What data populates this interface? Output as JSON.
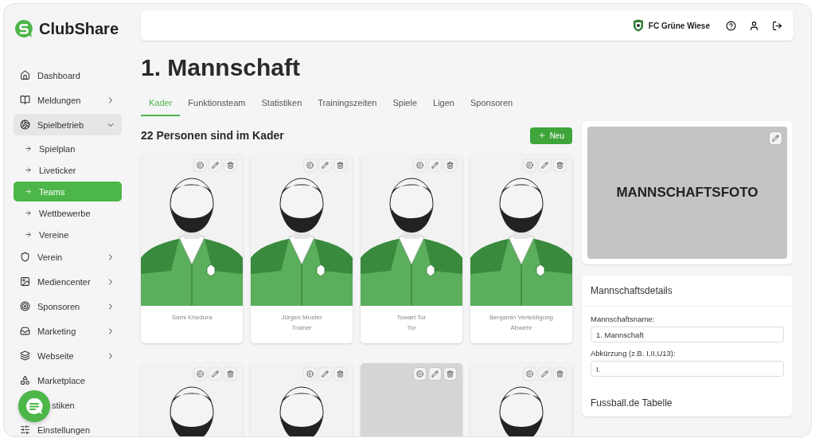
{
  "brand": {
    "name": "ClubShare"
  },
  "sidebar": {
    "items": [
      {
        "kind": "main",
        "label": "Dashboard",
        "expandable": false,
        "expanded": false,
        "selected": false
      },
      {
        "kind": "main",
        "label": "Meldungen",
        "expandable": true,
        "expanded": false,
        "selected": false
      },
      {
        "kind": "main",
        "label": "Spielbetrieb",
        "expandable": true,
        "expanded": true,
        "selected": false
      },
      {
        "kind": "sub",
        "label": "Spielplan",
        "selected": false
      },
      {
        "kind": "sub",
        "label": "Liveticker",
        "selected": false
      },
      {
        "kind": "sub",
        "label": "Teams",
        "selected": true
      },
      {
        "kind": "sub",
        "label": "Wettbewerbe",
        "selected": false
      },
      {
        "kind": "sub",
        "label": "Vereine",
        "selected": false
      },
      {
        "kind": "main",
        "label": "Verein",
        "expandable": true,
        "expanded": false,
        "selected": false
      },
      {
        "kind": "main",
        "label": "Mediencenter",
        "expandable": true,
        "expanded": false,
        "selected": false
      },
      {
        "kind": "main",
        "label": "Sponsoren",
        "expandable": true,
        "expanded": false,
        "selected": false
      },
      {
        "kind": "main",
        "label": "Marketing",
        "expandable": true,
        "expanded": false,
        "selected": false
      },
      {
        "kind": "main",
        "label": "Webseite",
        "expandable": true,
        "expanded": false,
        "selected": false
      },
      {
        "kind": "main",
        "label": "Marketplace",
        "expandable": false,
        "expanded": false,
        "selected": false
      },
      {
        "kind": "covered",
        "label": "stiken",
        "expandable": false,
        "expanded": false,
        "selected": false
      },
      {
        "kind": "main",
        "label": "Einstellungen",
        "expandable": false,
        "expanded": false,
        "selected": false
      }
    ]
  },
  "header": {
    "club": "FC Grüne Wiese"
  },
  "page": {
    "title": "1. Mannschaft"
  },
  "tabs": [
    {
      "label": "Kader",
      "selected": true
    },
    {
      "label": "Funktionsteam",
      "selected": false
    },
    {
      "label": "Statistiken",
      "selected": false
    },
    {
      "label": "Trainingszeiten",
      "selected": false
    },
    {
      "label": "Spiele",
      "selected": false
    },
    {
      "label": "Ligen",
      "selected": false
    },
    {
      "label": "Sponsoren",
      "selected": false
    }
  ],
  "squad": {
    "heading": "22 Personen sind im Kader",
    "new_button": "Neu",
    "cards": [
      {
        "kind": "avatar",
        "name": "Sami Khedura"
      },
      {
        "kind": "avatar",
        "name": "Jürgen Muster",
        "role": "Trainer"
      },
      {
        "kind": "avatar",
        "name": "Towart Tor",
        "role": "Tor"
      },
      {
        "kind": "avatar",
        "name": "Benjamin Verteidigung",
        "role": "Abwehr"
      },
      {
        "kind": "avatar"
      },
      {
        "kind": "avatar"
      },
      {
        "kind": "empty"
      },
      {
        "kind": "avatar"
      }
    ]
  },
  "team_photo": {
    "placeholder": "MANNSCHAFTSFOTO"
  },
  "details": {
    "title": "Mannschaftsdetails",
    "fields": [
      {
        "label": "Mannschaftsname:",
        "value": "1. Mannschaft"
      },
      {
        "label": "Abkürzung (z.B. I,II,U13):",
        "value": "I."
      }
    ],
    "table_title": "Fussball.de Tabelle"
  }
}
